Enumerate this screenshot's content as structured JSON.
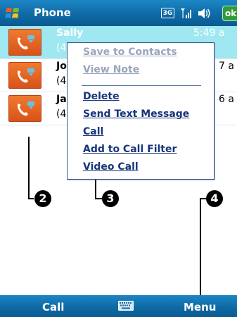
{
  "title_bar": {
    "app_title": "Phone",
    "network_badge": "3G",
    "ok_label": "ok",
    "icons": [
      "windows-start-icon",
      "signal-icon",
      "volume-icon"
    ]
  },
  "call_list": [
    {
      "name": "Sally",
      "number": "(4",
      "time": "5:49 a",
      "selected": true
    },
    {
      "name": "Jo",
      "number": "(4",
      "time": "7 a",
      "selected": false
    },
    {
      "name": "Ja",
      "number": "(4",
      "time": "6 a",
      "selected": false
    }
  ],
  "context_menu": {
    "items": [
      {
        "label": "Save to Contacts",
        "enabled": false
      },
      {
        "label": "View Note",
        "enabled": false
      },
      {
        "label": "Delete",
        "enabled": true
      },
      {
        "label": "Send Text Message",
        "enabled": true
      },
      {
        "label": "Call",
        "enabled": true
      },
      {
        "label": "Add to Call Filter",
        "enabled": true
      },
      {
        "label": "Video Call",
        "enabled": true
      }
    ]
  },
  "callouts": [
    "2",
    "3",
    "4"
  ],
  "softkeys": {
    "left": "Call",
    "right": "Menu"
  },
  "colors": {
    "titlebar": "#0f6aa6",
    "selection": "#9fe8f2",
    "call_icon": "#e0621f",
    "menu_text": "#17357a"
  }
}
